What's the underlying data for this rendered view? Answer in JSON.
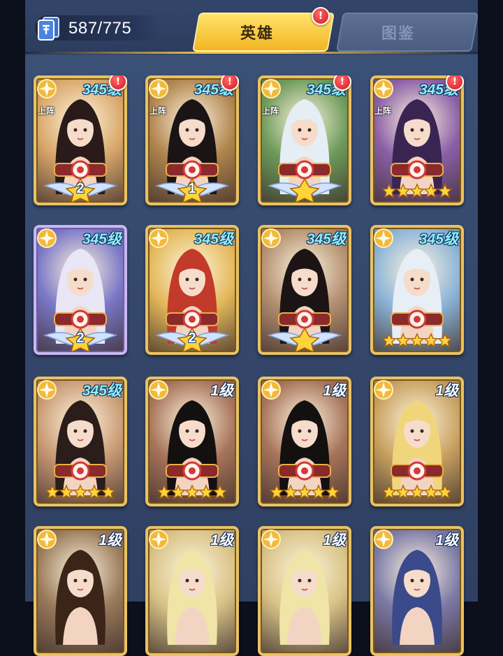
{
  "header": {
    "card_count": "587/775",
    "icons": {
      "deck": "card-deck-icon",
      "alert": "exclamation-icon"
    },
    "tabs": [
      {
        "label": "英雄",
        "active": true,
        "alert": "!"
      },
      {
        "label": "图鉴",
        "active": false
      }
    ]
  },
  "colors": {
    "accent": "#f2b524",
    "panel": "#3d5278",
    "level_text": "#8ff0ff",
    "alert": "#d4141b"
  },
  "heroes": [
    {
      "level": "345级",
      "lineup": "上阵",
      "alert": "!",
      "rank": "wings",
      "wing_number": "2",
      "stars": 0,
      "hair": "#2a1a1a",
      "bg": "#d9a76a",
      "frame": "gold"
    },
    {
      "level": "345级",
      "lineup": "上阵",
      "alert": "!",
      "rank": "wings",
      "wing_number": "1",
      "stars": 0,
      "hair": "#1a1414",
      "bg": "#b0844d",
      "frame": "gold"
    },
    {
      "level": "345级",
      "lineup": "上阵",
      "alert": "!",
      "rank": "wings",
      "wing_number": "",
      "stars": 0,
      "hair": "#e6eef5",
      "bg": "#6e9a5a",
      "frame": "gold"
    },
    {
      "level": "345级",
      "lineup": "上阵",
      "alert": "!",
      "rank": "stars",
      "wing_number": "",
      "stars": 5,
      "hair": "#3a2452",
      "bg": "#8a5fa6",
      "frame": "gold"
    },
    {
      "level": "345级",
      "lineup": "",
      "alert": "",
      "rank": "wings",
      "wing_number": "2",
      "stars": 0,
      "hair": "#e9e6f5",
      "bg": "#7a77c6",
      "frame": "purple"
    },
    {
      "level": "345级",
      "lineup": "",
      "alert": "",
      "rank": "wings",
      "wing_number": "2",
      "stars": 0,
      "hair": "#c23a2a",
      "bg": "#e4b85a",
      "frame": "gold"
    },
    {
      "level": "345级",
      "lineup": "",
      "alert": "",
      "rank": "wings",
      "wing_number": "",
      "stars": 0,
      "hair": "#1c1414",
      "bg": "#b49070",
      "frame": "gold"
    },
    {
      "level": "345级",
      "lineup": "",
      "alert": "",
      "rank": "stars",
      "wing_number": "",
      "stars": 5,
      "hair": "#e8eef6",
      "bg": "#8cb4d6",
      "frame": "gold"
    },
    {
      "level": "345级",
      "lineup": "",
      "alert": "",
      "rank": "stars",
      "wing_number": "",
      "stars": 5,
      "hair": "#2a1d1a",
      "bg": "#c99a74",
      "frame": "gold"
    },
    {
      "level": "1级",
      "lineup": "",
      "alert": "",
      "rank": "stars",
      "wing_number": "",
      "stars": 5,
      "hair": "#141010",
      "bg": "#a7745a",
      "frame": "gold"
    },
    {
      "level": "1级",
      "lineup": "",
      "alert": "",
      "rank": "stars",
      "wing_number": "",
      "stars": 5,
      "hair": "#141010",
      "bg": "#a7745a",
      "frame": "gold"
    },
    {
      "level": "1级",
      "lineup": "",
      "alert": "",
      "rank": "stars",
      "wing_number": "",
      "stars": 5,
      "hair": "#f1d57a",
      "bg": "#c8a160",
      "frame": "gold"
    },
    {
      "level": "1级",
      "lineup": "",
      "alert": "",
      "rank": "none",
      "wing_number": "",
      "stars": 0,
      "hair": "#3a2518",
      "bg": "#9a7a5a",
      "frame": "gold"
    },
    {
      "level": "1级",
      "lineup": "",
      "alert": "",
      "rank": "none",
      "wing_number": "",
      "stars": 0,
      "hair": "#f0e4a6",
      "bg": "#d9c287",
      "frame": "gold"
    },
    {
      "level": "1级",
      "lineup": "",
      "alert": "",
      "rank": "none",
      "wing_number": "",
      "stars": 0,
      "hair": "#f0e4a6",
      "bg": "#d9c287",
      "frame": "gold"
    },
    {
      "level": "1级",
      "lineup": "",
      "alert": "",
      "rank": "none",
      "wing_number": "",
      "stars": 0,
      "hair": "#3a4a8a",
      "bg": "#7c7aa6",
      "frame": "gold"
    }
  ]
}
